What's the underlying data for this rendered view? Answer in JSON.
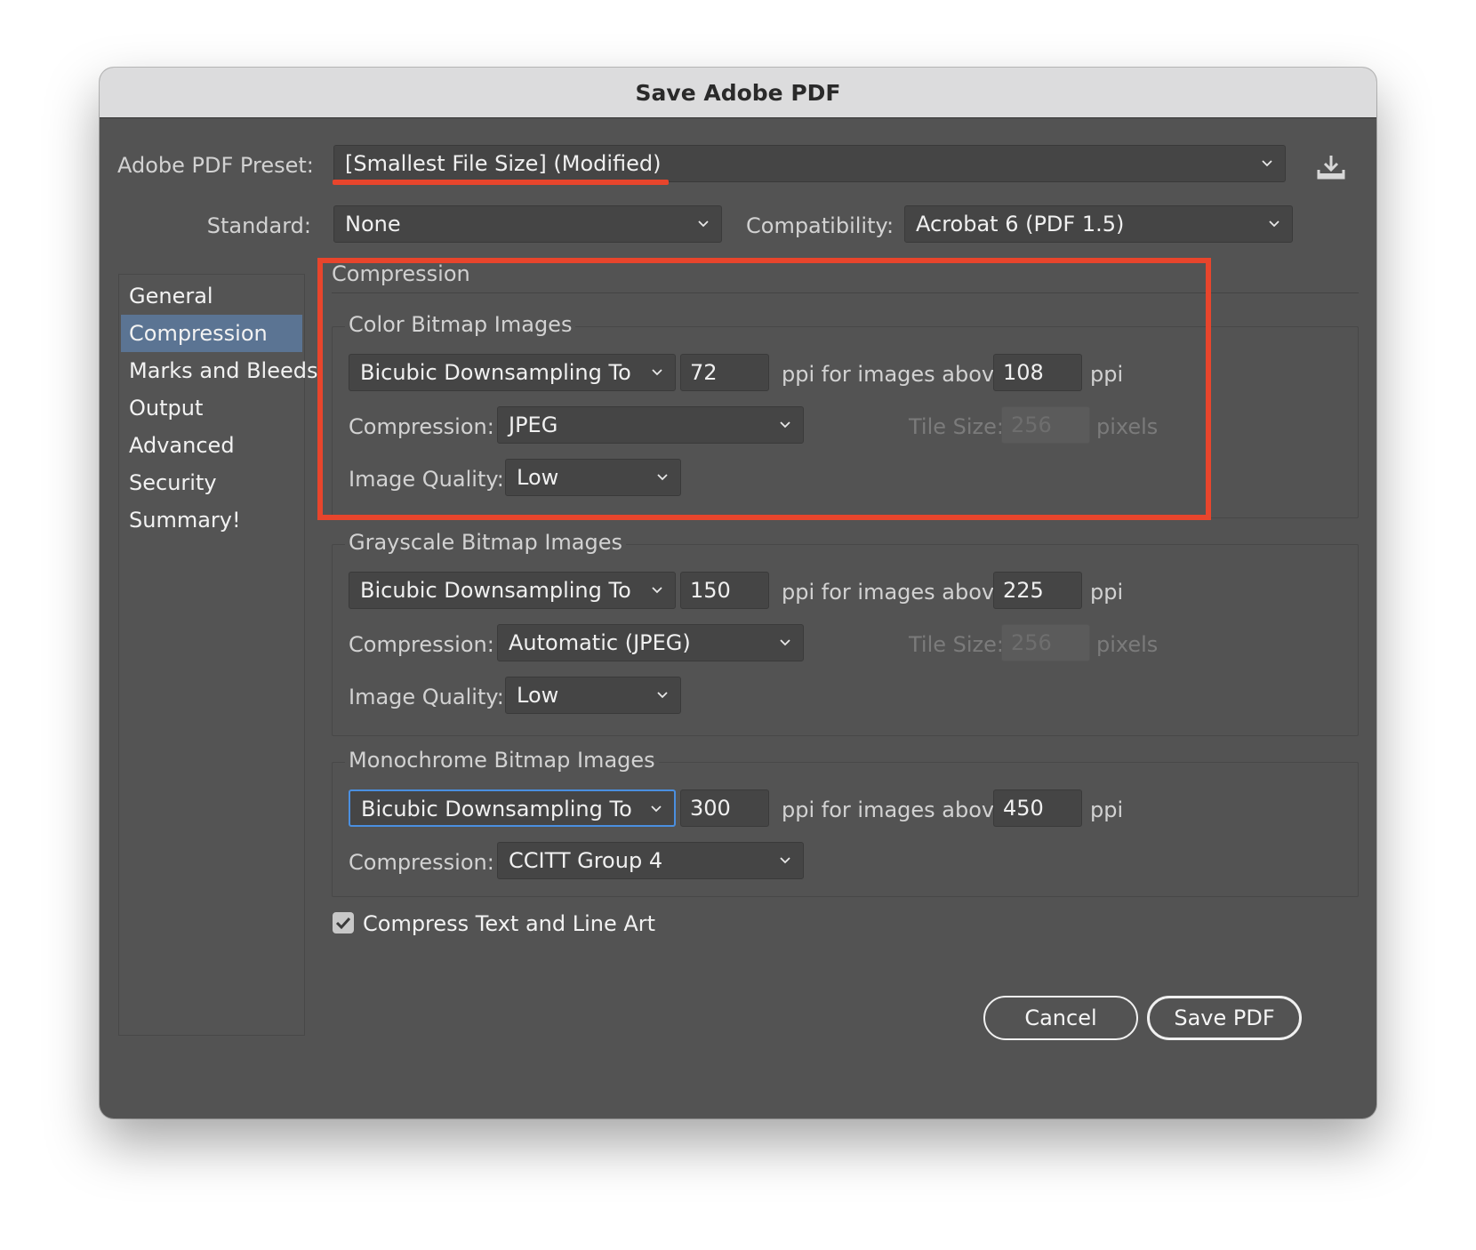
{
  "dialog": {
    "title": "Save Adobe PDF"
  },
  "preset": {
    "label": "Adobe PDF Preset:",
    "value": "[Smallest File Size] (Modified)",
    "save_icon": "download-icon"
  },
  "standard": {
    "label": "Standard:",
    "value": "None"
  },
  "compatibility": {
    "label": "Compatibility:",
    "value": "Acrobat 6 (PDF 1.5)"
  },
  "sidebar": {
    "items": [
      {
        "label": "General"
      },
      {
        "label": "Compression"
      },
      {
        "label": "Marks and Bleeds"
      },
      {
        "label": "Output"
      },
      {
        "label": "Advanced"
      },
      {
        "label": "Security"
      },
      {
        "label": "Summary!"
      }
    ],
    "selected": "Compression"
  },
  "panel": {
    "title": "Compression"
  },
  "color": {
    "title": "Color Bitmap Images",
    "downsampling": "Bicubic Downsampling To",
    "ppi": "72",
    "above_label": "ppi for images above",
    "above": "108",
    "ppi_unit": "ppi",
    "compression_label": "Compression:",
    "compression": "JPEG",
    "tile_label": "Tile Size:",
    "tile": "256",
    "tile_unit": "pixels",
    "quality_label": "Image Quality:",
    "quality": "Low"
  },
  "gray": {
    "title": "Grayscale Bitmap Images",
    "downsampling": "Bicubic Downsampling To",
    "ppi": "150",
    "above_label": "ppi for images above",
    "above": "225",
    "ppi_unit": "ppi",
    "compression_label": "Compression:",
    "compression": "Automatic (JPEG)",
    "tile_label": "Tile Size:",
    "tile": "256",
    "tile_unit": "pixels",
    "quality_label": "Image Quality:",
    "quality": "Low"
  },
  "mono": {
    "title": "Monochrome Bitmap Images",
    "downsampling": "Bicubic Downsampling To",
    "ppi": "300",
    "above_label": "ppi for images above",
    "above": "450",
    "ppi_unit": "ppi",
    "compression_label": "Compression:",
    "compression": "CCITT Group 4"
  },
  "compress_text": {
    "label": "Compress Text and Line Art",
    "checked": true
  },
  "buttons": {
    "cancel": "Cancel",
    "save": "Save PDF"
  },
  "colors": {
    "window_bg": "#535353",
    "annotation_red": "#e8452c",
    "selection": "#5b7493"
  }
}
